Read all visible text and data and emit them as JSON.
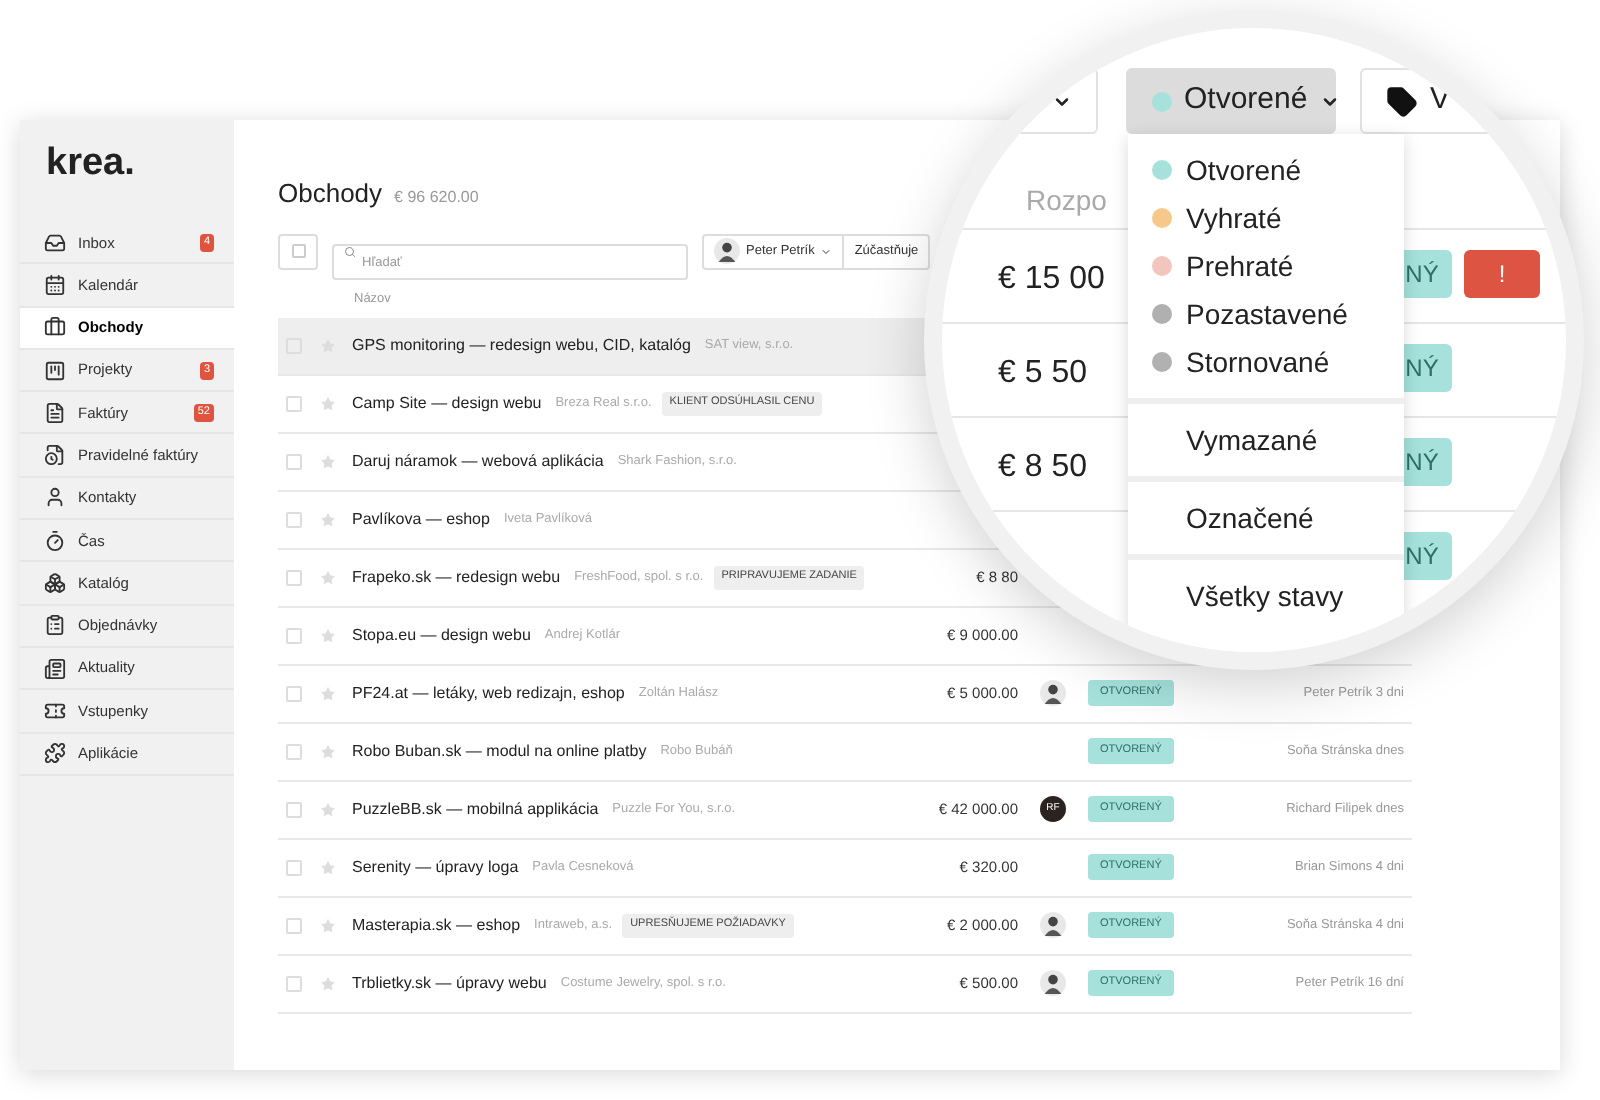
{
  "app": {
    "logo": "krea."
  },
  "sidebar": {
    "items": [
      {
        "label": "Inbox",
        "badge": "4",
        "selected": false
      },
      {
        "label": "Kalendár",
        "selected": false
      },
      {
        "label": "Obchody",
        "selected": true
      },
      {
        "label": "Projekty",
        "badge": "3",
        "selected": false
      },
      {
        "label": "Faktúry",
        "badge": "52",
        "selected": false
      },
      {
        "label": "Pravidelné faktúry",
        "selected": false
      },
      {
        "label": "Kontakty",
        "selected": false
      },
      {
        "label": "Čas",
        "selected": false
      },
      {
        "label": "Katalóg",
        "selected": false
      },
      {
        "label": "Objednávky",
        "selected": false
      },
      {
        "label": "Aktuality",
        "selected": false
      },
      {
        "label": "Vstupenky",
        "selected": false
      },
      {
        "label": "Aplikácie",
        "selected": false
      }
    ]
  },
  "header": {
    "title": "Obchody",
    "total": "€ 96 620.00"
  },
  "toolbar": {
    "select_all_checked": false,
    "search_placeholder": "Hľadať",
    "person": "Peter Petrík",
    "participant_filter": "Zúčastňuje"
  },
  "table": {
    "columns": [
      "Názov"
    ],
    "rows": [
      {
        "title": "GPS monitoring — redesign webu, CID, katalóg",
        "client": "SAT view, s.r.o.",
        "highlighted": true
      },
      {
        "title": "Camp Site — design webu",
        "client": "Breza Real s.r.o.",
        "tag": "KLIENT ODSÚHLASIL CENU",
        "highlighted": false
      },
      {
        "title": "Daruj náramok — webová aplikácia",
        "client": "Shark Fashion, s.r.o.",
        "highlighted": false
      },
      {
        "title": "Pavlíkova — eshop",
        "client": "Iveta Pavlíková",
        "highlighted": false
      },
      {
        "title": "Frapeko.sk — redesign webu",
        "client": "FreshFood, spol. s r.o.",
        "tag": "PRIPRAVUJEME ZADANIE",
        "amount": "€ 8 80",
        "highlighted": false
      },
      {
        "title": "Stopa.eu — design webu",
        "client": "Andrej Kotlár",
        "amount": "€ 9 000.00",
        "highlighted": false
      },
      {
        "title": "PF24.at — letáky, web redizajn, eshop",
        "client": "Zoltán Halász",
        "amount": "€ 5 000.00",
        "avatar": {
          "kind": "photo"
        },
        "status": {
          "label": "OTVORENÝ",
          "kind": "open"
        },
        "owner": "Peter Petrík 3 dni",
        "highlighted": false
      },
      {
        "title": "Robo Buban.sk — modul na online platby",
        "client": "Robo Bubáň",
        "status": {
          "label": "OTVORENÝ",
          "kind": "open"
        },
        "owner": "Soňa Stránska dnes",
        "highlighted": false
      },
      {
        "title": "PuzzleBB.sk — mobilná applikácia",
        "client": "Puzzle For You, s.r.o.",
        "amount": "€ 42 000.00",
        "avatar": {
          "kind": "initials",
          "text": "RF"
        },
        "status": {
          "label": "OTVORENÝ",
          "kind": "open"
        },
        "owner": "Richard Filipek dnes",
        "highlighted": false
      },
      {
        "title": "Serenity — úpravy loga",
        "client": "Pavla Cesneková",
        "amount": "€ 320.00",
        "status": {
          "label": "OTVORENÝ",
          "kind": "open"
        },
        "owner": "Brian Simons 4 dni",
        "highlighted": false
      },
      {
        "title": "Masterapia.sk — eshop",
        "client": "Intraweb, a.s.",
        "tag": "UPRESŇUJEME POŽIADAVKY",
        "amount": "€ 2 000.00",
        "avatar": {
          "kind": "photo"
        },
        "status": {
          "label": "OTVORENÝ",
          "kind": "open"
        },
        "owner": "Soňa Stránska 4 dni",
        "highlighted": false
      },
      {
        "title": "Trblietky.sk — úpravy webu",
        "client": "Costume Jewelry, spol. s r.o.",
        "amount": "€ 500.00",
        "avatar": {
          "kind": "photo"
        },
        "status": {
          "label": "OTVORENÝ",
          "kind": "open"
        },
        "owner": "Peter Petrík 16 dní",
        "highlighted": false
      }
    ]
  },
  "magnifier": {
    "filter_buttons": [
      {
        "kind": "chevron",
        "selected": false
      },
      {
        "kind": "status",
        "label": "Otvorené",
        "color": "#a6e1db",
        "selected": true
      },
      {
        "kind": "tag",
        "label": "V",
        "selected": false
      }
    ],
    "column_header": "Rozpo",
    "rows": [
      {
        "amount": "€ 15 00",
        "status": "NÝ",
        "alert": "!"
      },
      {
        "amount": "€ 5 50",
        "status": "NÝ"
      },
      {
        "amount": "€ 8 50",
        "status": "NÝ"
      },
      {
        "status": "NÝ"
      }
    ],
    "dropdown": {
      "groups": [
        [
          {
            "label": "Otvorené",
            "color": "#a6e1db"
          },
          {
            "label": "Vyhraté",
            "color": "#f6c98a"
          },
          {
            "label": "Prehraté",
            "color": "#f2c5bf"
          },
          {
            "label": "Pozastavené",
            "color": "#b0b0b0"
          },
          {
            "label": "Stornované",
            "color": "#b1b1b1"
          }
        ],
        [
          {
            "label": "Vymazané"
          }
        ],
        [
          {
            "label": "Označené"
          }
        ],
        [
          {
            "label": "Všetky stavy"
          }
        ]
      ]
    }
  }
}
